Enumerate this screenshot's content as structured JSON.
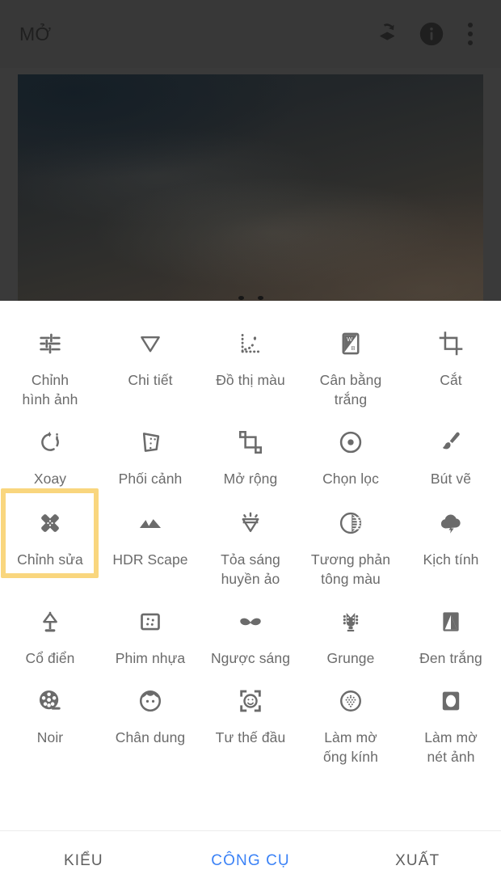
{
  "app": {
    "title": "MỞ",
    "accent_blue": "#3b82f6",
    "highlight_yellow": "#f9d67e",
    "icon_gray": "#6b6b6b",
    "appbar_bg": "#383838"
  },
  "appbar": {
    "title": "MỞ",
    "icons": [
      {
        "name": "revert-layers-icon",
        "label": "Hoàn tác"
      },
      {
        "name": "info-icon",
        "label": "Thông tin"
      },
      {
        "name": "overflow-menu-icon",
        "label": "Tùy chọn khác"
      }
    ]
  },
  "preview": {
    "page_dots": 2
  },
  "tools": {
    "rows": [
      [
        {
          "label": "Chỉnh\nhình ảnh",
          "icon": "tune-icon",
          "selected": false
        },
        {
          "label": "Chi tiết",
          "icon": "details-triangle-icon",
          "selected": false
        },
        {
          "label": "Đồ thị màu",
          "icon": "curves-icon",
          "selected": false
        },
        {
          "label": "Cân bằng\ntrắng",
          "icon": "white-balance-icon",
          "selected": false
        },
        {
          "label": "Cắt",
          "icon": "crop-icon",
          "selected": false
        }
      ],
      [
        {
          "label": "Xoay",
          "icon": "rotate-icon",
          "selected": false
        },
        {
          "label": "Phối cảnh",
          "icon": "perspective-icon",
          "selected": false
        },
        {
          "label": "Mở rộng",
          "icon": "expand-icon",
          "selected": false
        },
        {
          "label": "Chọn lọc",
          "icon": "selective-icon",
          "selected": false
        },
        {
          "label": "Bút vẽ",
          "icon": "brush-icon",
          "selected": false
        }
      ],
      [
        {
          "label": "Chỉnh sửa",
          "icon": "healing-patch-icon",
          "selected": true
        },
        {
          "label": "HDR Scape",
          "icon": "mountains-icon",
          "selected": false
        },
        {
          "label": "Tỏa sáng\nhuyền ảo",
          "icon": "glamour-gem-icon",
          "selected": false
        },
        {
          "label": "Tương phản\ntông màu",
          "icon": "tonal-contrast-icon",
          "selected": false
        },
        {
          "label": "Kịch tính",
          "icon": "storm-cloud-icon",
          "selected": false
        }
      ],
      [
        {
          "label": "Cổ điển",
          "icon": "lamp-icon",
          "selected": false
        },
        {
          "label": "Phim nhựa",
          "icon": "grainy-film-icon",
          "selected": false
        },
        {
          "label": "Ngược sáng",
          "icon": "moustache-icon",
          "selected": false
        },
        {
          "label": "Grunge",
          "icon": "guitar-headstock-icon",
          "selected": false
        },
        {
          "label": "Đen trắng",
          "icon": "black-white-icon",
          "selected": false
        }
      ],
      [
        {
          "label": "Noir",
          "icon": "film-reel-icon",
          "selected": false
        },
        {
          "label": "Chân dung",
          "icon": "portrait-face-icon",
          "selected": false
        },
        {
          "label": "Tư thế đầu",
          "icon": "head-pose-icon",
          "selected": false
        },
        {
          "label": "Làm mờ\nống kính",
          "icon": "lens-blur-icon",
          "selected": false
        },
        {
          "label": "Làm mờ\nnét ảnh",
          "icon": "vignette-blur-icon",
          "selected": false
        }
      ]
    ]
  },
  "tabbar": {
    "tabs": [
      {
        "label": "KIỂU",
        "active": false
      },
      {
        "label": "CÔNG CỤ",
        "active": true
      },
      {
        "label": "XUẤT",
        "active": false
      }
    ]
  }
}
